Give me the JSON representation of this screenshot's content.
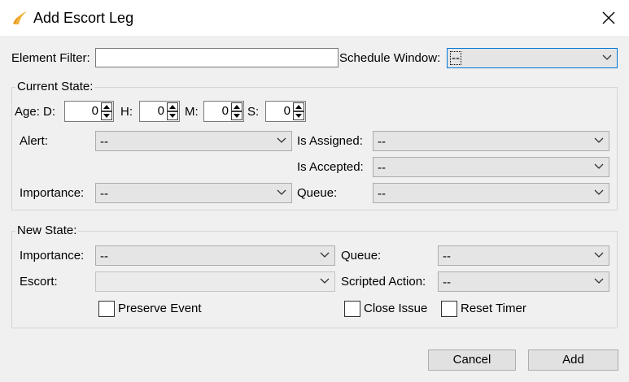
{
  "window": {
    "title": "Add Escort Leg",
    "icon": "wing-logo-icon",
    "close_icon": "close-icon"
  },
  "filter_row": {
    "element_filter_label": "Element Filter:",
    "element_filter_value": "",
    "schedule_window_label": "Schedule Window:",
    "schedule_window_value": "--"
  },
  "current_state": {
    "title": "Current State:",
    "age_label": "Age: D:",
    "d_value": "0",
    "h_label": "H:",
    "h_value": "0",
    "m_label": "M:",
    "m_value": "0",
    "s_label": "S:",
    "s_value": "0",
    "alert_label": "Alert:",
    "alert_value": "--",
    "is_assigned_label": "Is Assigned:",
    "is_assigned_value": "--",
    "is_accepted_label": "Is Accepted:",
    "is_accepted_value": "--",
    "importance_label": "Importance:",
    "importance_value": "--",
    "queue_label": "Queue:",
    "queue_value": "--"
  },
  "new_state": {
    "title": "New State:",
    "importance_label": "Importance:",
    "importance_value": "--",
    "queue_label": "Queue:",
    "queue_value": "--",
    "escort_label": "Escort:",
    "escort_value": "",
    "scripted_action_label": "Scripted Action:",
    "scripted_action_value": "--",
    "preserve_event_label": "Preserve Event",
    "preserve_event_checked": false,
    "close_issue_label": "Close Issue",
    "close_issue_checked": false,
    "reset_timer_label": "Reset Timer",
    "reset_timer_checked": false
  },
  "buttons": {
    "cancel": "Cancel",
    "add": "Add"
  },
  "colors": {
    "dialog_bg": "#f0f0f0",
    "titlebar_bg": "#ffffff",
    "combo_bg": "#e5e5e5",
    "logo": "#f2b33d"
  }
}
